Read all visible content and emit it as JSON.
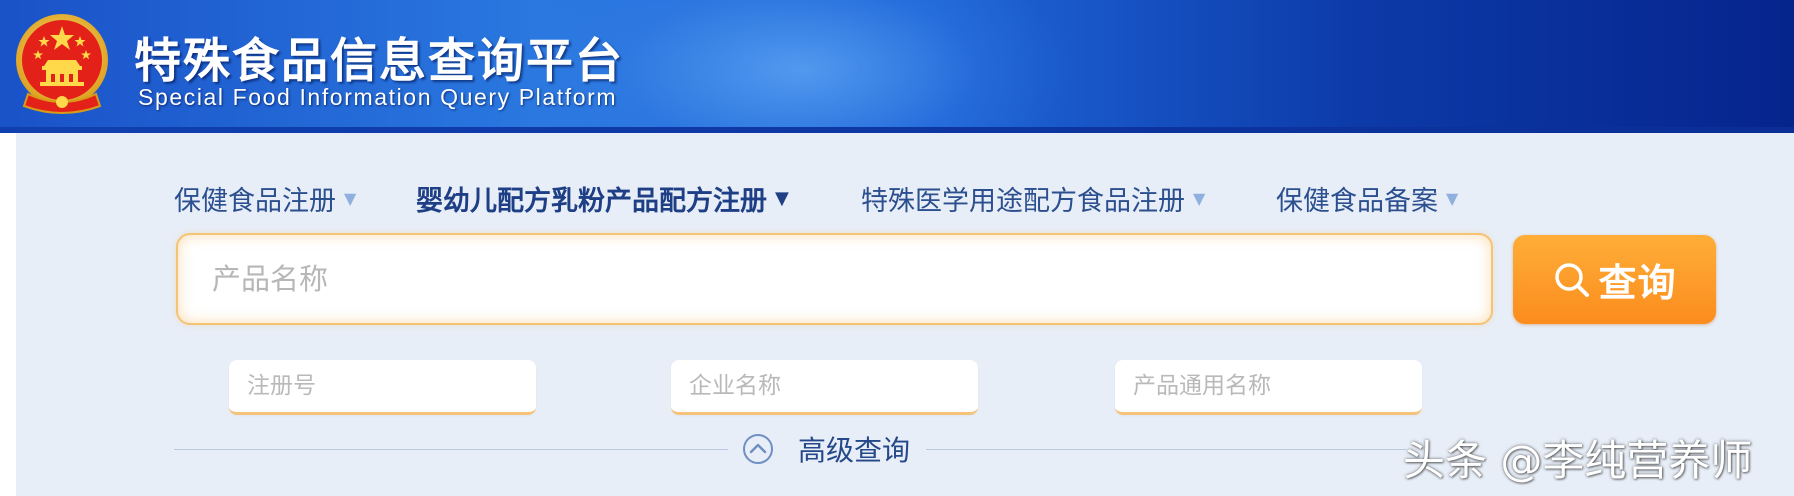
{
  "header": {
    "title_cn": "特殊食品信息查询平台",
    "title_en": "Special Food Information Query Platform",
    "emblem_icon": "national-emblem-icon"
  },
  "nav": {
    "tabs": [
      {
        "label": "保健食品注册",
        "active": false
      },
      {
        "label": "婴幼儿配方乳粉产品配方注册",
        "active": true
      },
      {
        "label": "特殊医学用途配方食品注册",
        "active": false
      },
      {
        "label": "保健食品备案",
        "active": false
      }
    ],
    "caret_glyph": "▼"
  },
  "search": {
    "placeholder": "产品名称",
    "value": "",
    "button_label": "查询",
    "button_icon": "search-icon"
  },
  "filters": {
    "registration_no_placeholder": "注册号",
    "company_name_placeholder": "企业名称",
    "generic_name_placeholder": "产品通用名称"
  },
  "advanced": {
    "label": "高级查询",
    "icon": "chevron-up-circle-icon"
  },
  "watermark": "头条 @李纯营养师",
  "colors": {
    "header_blue": "#1f66d8",
    "panel_bg": "#e8eef7",
    "tab_text": "#2b4f8f",
    "accent_orange": "#fb8c1d",
    "input_border": "#f5c374"
  }
}
